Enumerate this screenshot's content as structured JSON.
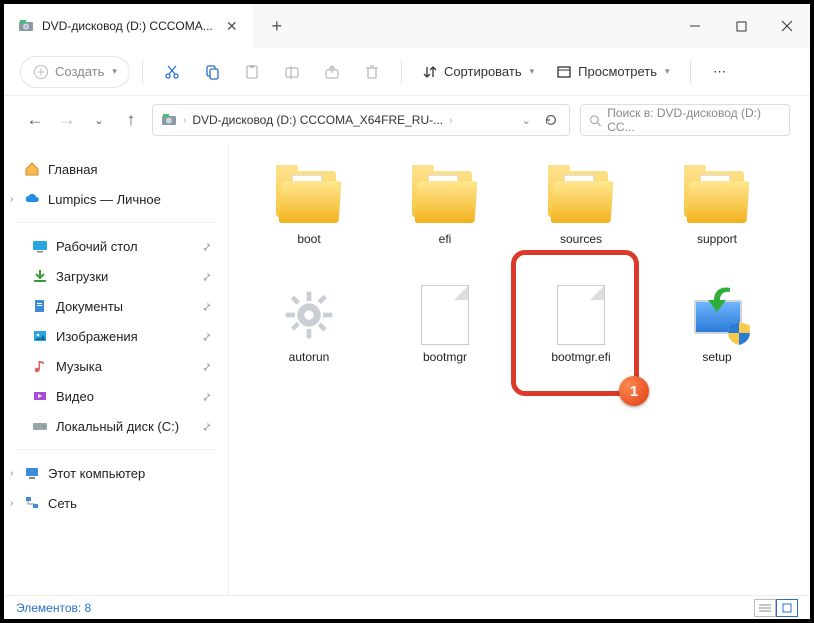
{
  "titlebar": {
    "tab_title": "DVD-дисковод (D:) CCCOMA..."
  },
  "toolbar": {
    "create": "Создать",
    "sort": "Сортировать",
    "view": "Просмотреть"
  },
  "address": {
    "path": "DVD-дисковод (D:) CCCOMA_X64FRE_RU-...",
    "search_placeholder": "Поиск в: DVD-дисковод (D:) CC..."
  },
  "sidebar": {
    "home": "Главная",
    "personal": "Lumpics — Личное",
    "desktop": "Рабочий стол",
    "downloads": "Загрузки",
    "documents": "Документы",
    "pictures": "Изображения",
    "music": "Музыка",
    "videos": "Видео",
    "localdisk": "Локальный диск (C:)",
    "thispc": "Этот компьютер",
    "network": "Сеть"
  },
  "files": {
    "boot": "boot",
    "efi": "efi",
    "sources": "sources",
    "support": "support",
    "autorun": "autorun",
    "bootmgr": "bootmgr",
    "bootmgr_efi": "bootmgr.efi",
    "setup": "setup"
  },
  "status": {
    "count": "Элементов: 8"
  },
  "annotation": {
    "badge": "1"
  }
}
